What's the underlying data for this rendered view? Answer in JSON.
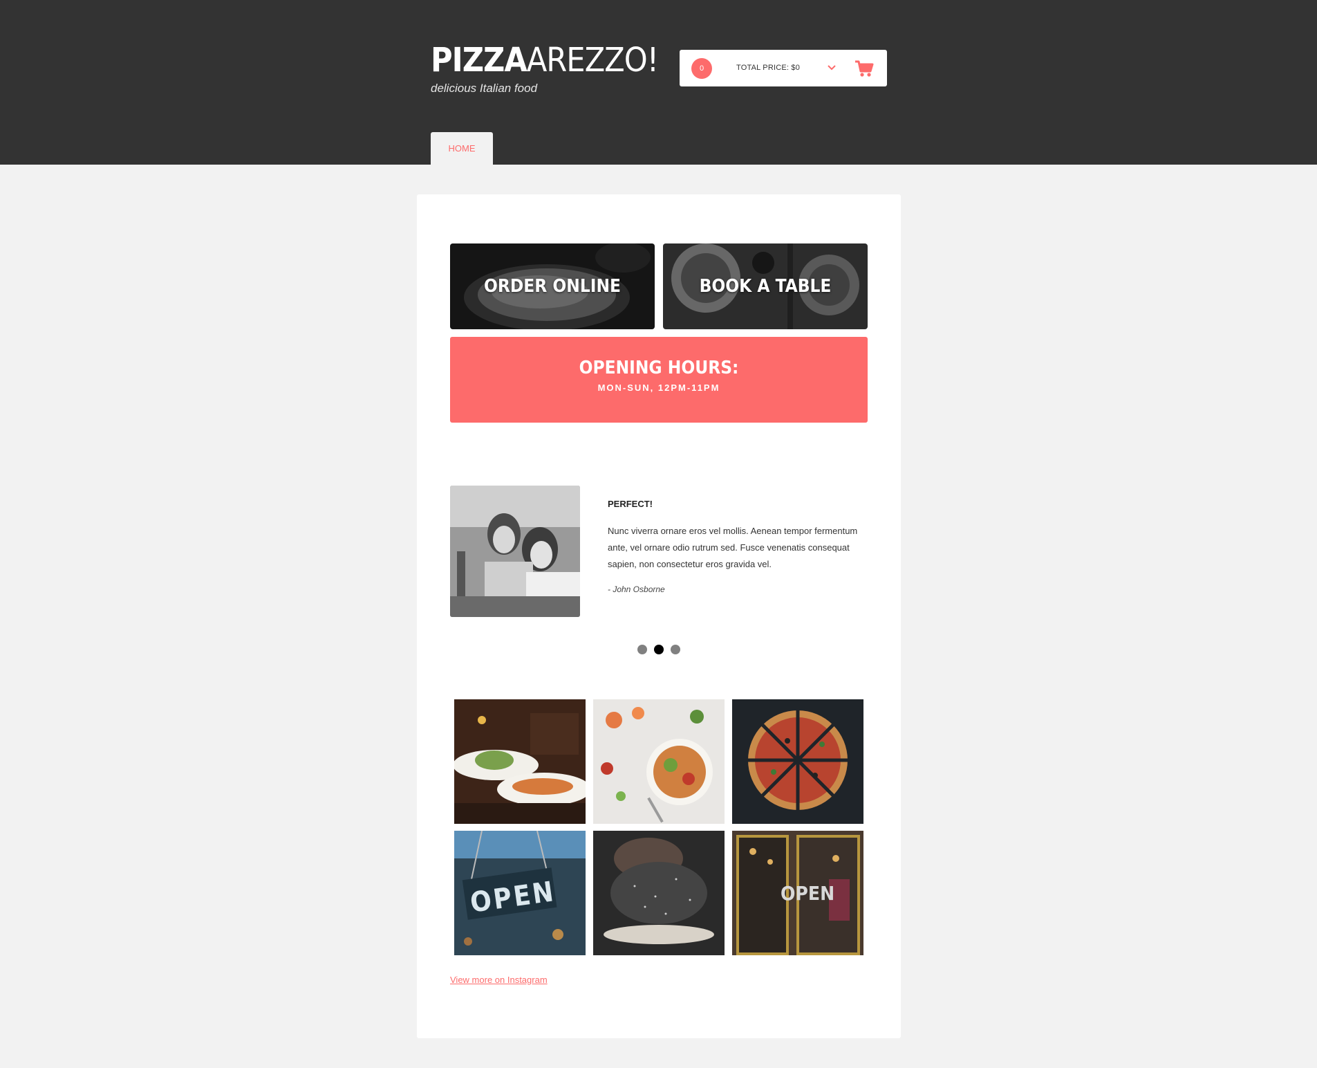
{
  "brand": {
    "name_bold": "PIZZA",
    "name_light": "AREZZO!",
    "tagline": "delicious Italian food"
  },
  "cart": {
    "count": "0",
    "total_label": "TOTAL PRICE: $0",
    "chevron_icon": "chevron-down-icon",
    "cart_icon": "shopping-cart-icon"
  },
  "nav": {
    "tabs": [
      {
        "label": "HOME"
      }
    ]
  },
  "tiles": {
    "order_online": "ORDER ONLINE",
    "book_table": "BOOK A TABLE"
  },
  "hours": {
    "title": "OPENING HOURS:",
    "schedule": "MON-SUN, 12PM-11PM"
  },
  "testimonial": {
    "title": "PERFECT!",
    "body": "Nunc viverra ornare eros vel mollis. Aenean tempor fermentum ante, vel ornare odio rutrum sed. Fusce venenatis consequat sapien, non consectetur eros gravida vel.",
    "author": "- John Osborne",
    "slide_count": 3,
    "active_slide": 2
  },
  "gallery": {
    "images": [
      {
        "name": "gallery-photo-restaurant-plates"
      },
      {
        "name": "gallery-photo-salad-bowl"
      },
      {
        "name": "gallery-photo-sliced-pizza"
      },
      {
        "name": "gallery-photo-open-sign",
        "sign_text": "OPEN"
      },
      {
        "name": "gallery-photo-flour-dough"
      },
      {
        "name": "gallery-photo-shop-door-open",
        "sign_text": "OPEN"
      }
    ],
    "link_label": "View more on Instagram"
  },
  "colors": {
    "header_bg": "#333333",
    "accent": "#fd6b6b",
    "page_bg": "#f2f2f2",
    "card_bg": "#ffffff"
  }
}
